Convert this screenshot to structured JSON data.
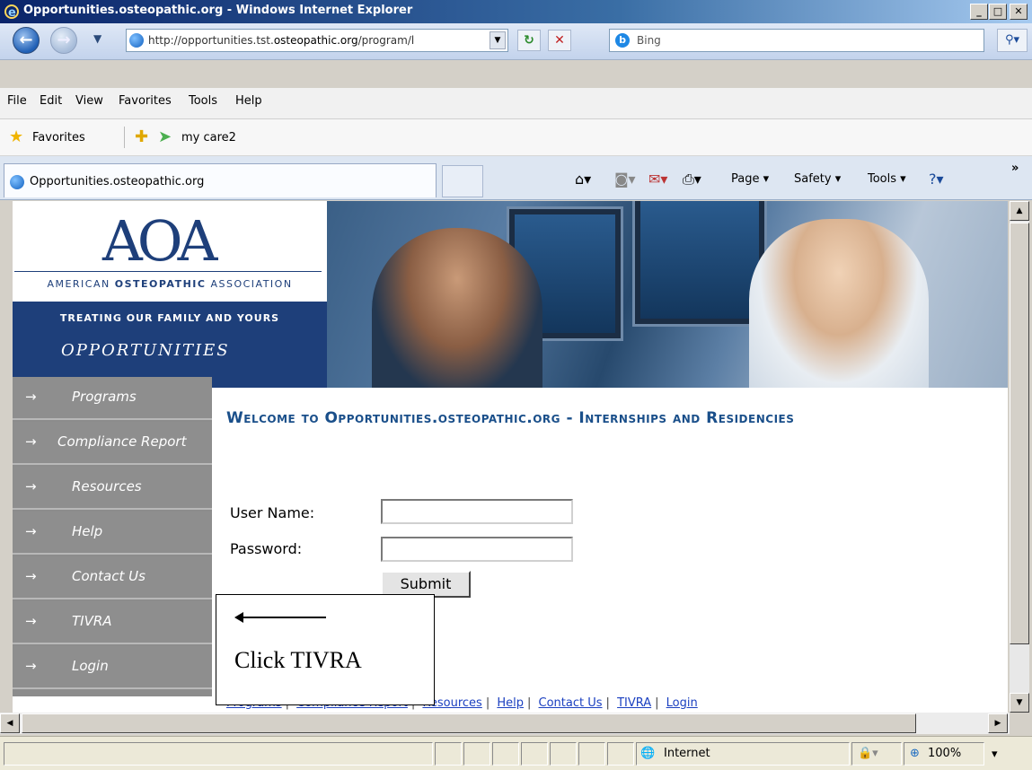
{
  "window": {
    "title": "Opportunities.osteopathic.org - Windows Internet Explorer",
    "min": "_",
    "max": "□",
    "close": "✕"
  },
  "address": {
    "url_prefix": "http://opportunities.tst.",
    "url_domain": "osteopathic.org",
    "url_suffix": "/program/l",
    "search_placeholder": "Bing"
  },
  "menu": {
    "items": [
      "File",
      "Edit",
      "View",
      "Favorites",
      "Tools",
      "Help"
    ]
  },
  "favorites": {
    "label": "Favorites",
    "link1": "my care2"
  },
  "tab": {
    "label": "Opportunities.osteopathic.org"
  },
  "commandbar": {
    "page": "Page ▾",
    "safety": "Safety ▾",
    "tools": "Tools ▾",
    "more": "»"
  },
  "banner": {
    "logo_mark": "AOA",
    "association_prefix": "AMERICAN",
    "association_bold": "OSTEOPATHIC",
    "association_suffix": "ASSOCIATION",
    "tagline": "TREATING OUR FAMILY AND YOURS",
    "brand": "OPPORTUNITIES"
  },
  "sidebar": {
    "arrow": "→",
    "items": [
      {
        "label": "Programs"
      },
      {
        "label": "Compliance Report"
      },
      {
        "label": "Resources"
      },
      {
        "label": "Help"
      },
      {
        "label": "Contact Us"
      },
      {
        "label": "TIVRA"
      },
      {
        "label": "Login"
      }
    ]
  },
  "main": {
    "heading": "Welcome to Opportunities.osteopathic.org - Internships and Residencies",
    "username_label": "User Name:",
    "password_label": "Password:",
    "username_value": "",
    "password_value": "",
    "submit_label": "Submit",
    "footer_links": [
      "Programs",
      "Compliance Report",
      "Resources",
      "Help",
      "Contact Us",
      "TIVRA",
      "Login"
    ]
  },
  "callout": {
    "text": "Click TIVRA"
  },
  "status": {
    "zone": "Internet",
    "zoom": "100%"
  },
  "colors": {
    "accent": "#1e3f7a",
    "heading": "#1a4f8a",
    "sidebar": "#8e8e8e"
  }
}
